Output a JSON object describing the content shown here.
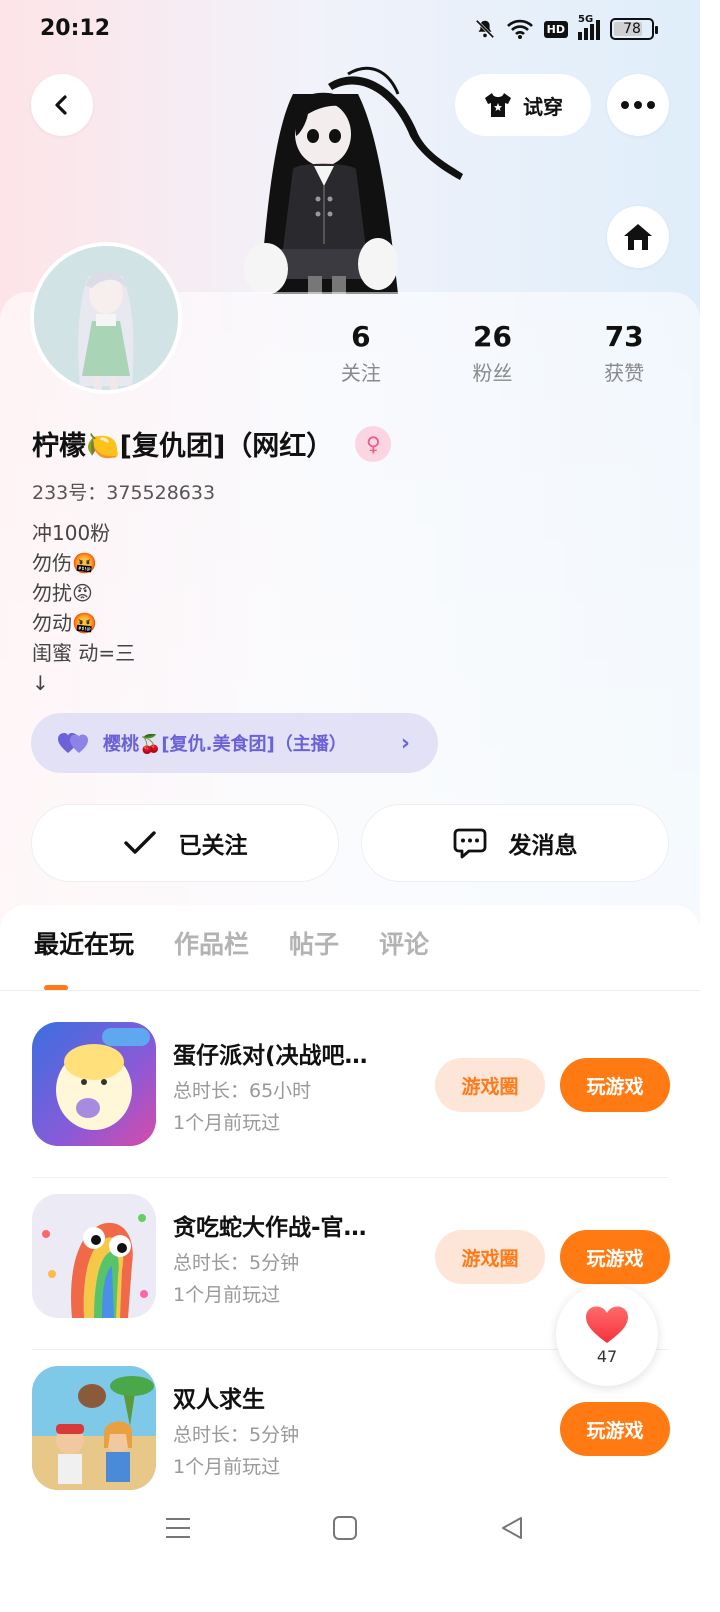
{
  "status_bar": {
    "time": "20:12",
    "battery": "78",
    "battery_level": 0.78,
    "network": "5G",
    "hd": "HD",
    "icons": [
      "bell-muted-icon",
      "wifi-icon",
      "hd-icon",
      "signal-icon",
      "battery-icon"
    ]
  },
  "header": {
    "back_icon": "chevron-left-icon",
    "tryon_label": "试穿",
    "tryon_icon": "shirt-icon",
    "more_icon": "more-dots-icon",
    "home_icon": "home-icon"
  },
  "profile": {
    "stats": [
      {
        "num": "6",
        "label": "关注"
      },
      {
        "num": "26",
        "label": "粉丝"
      },
      {
        "num": "73",
        "label": "获赞"
      }
    ],
    "nickname": "柠檬🍋[复仇团]（网红）",
    "gender_symbol": "♀",
    "uid": "233号：375528633",
    "bio_lines": [
      "冲100粉",
      "勿伤🤬",
      "勿扰😡",
      "勿动🤬",
      "闺蜜 动=三",
      "↓"
    ],
    "tag": {
      "icon": "double-heart-icon",
      "text": "樱桃🍒[复仇.美食团]（主播）",
      "chevron": "›"
    },
    "followed_label": "已关注",
    "message_label": "发消息"
  },
  "tabs": [
    "最近在玩",
    "作品栏",
    "帖子",
    "评论"
  ],
  "games": [
    {
      "title": "蛋仔派对(决战吧…",
      "duration": "总时长：65小时",
      "last_played": "1个月前玩过",
      "circle_label": "游戏圈",
      "play_label": "玩游戏"
    },
    {
      "title": "贪吃蛇大作战-官…",
      "duration": "总时长：5分钟",
      "last_played": "1个月前玩过",
      "circle_label": "游戏圈",
      "play_label": "玩游戏"
    },
    {
      "title": "双人求生",
      "duration": "总时长：5分钟",
      "last_played": "1个月前玩过",
      "circle_label": "",
      "play_label": "玩游戏"
    }
  ],
  "like_float": {
    "count": "47",
    "icon": "heart-icon"
  },
  "nav": {
    "icons": [
      "menu-icon",
      "home-square-icon",
      "back-triangle-icon"
    ]
  },
  "colors": {
    "accent": "#ff7a12",
    "tag_text": "#6b62d8",
    "tag_bg": "#e3e1f6",
    "circle_bg": "#fde6d8"
  }
}
